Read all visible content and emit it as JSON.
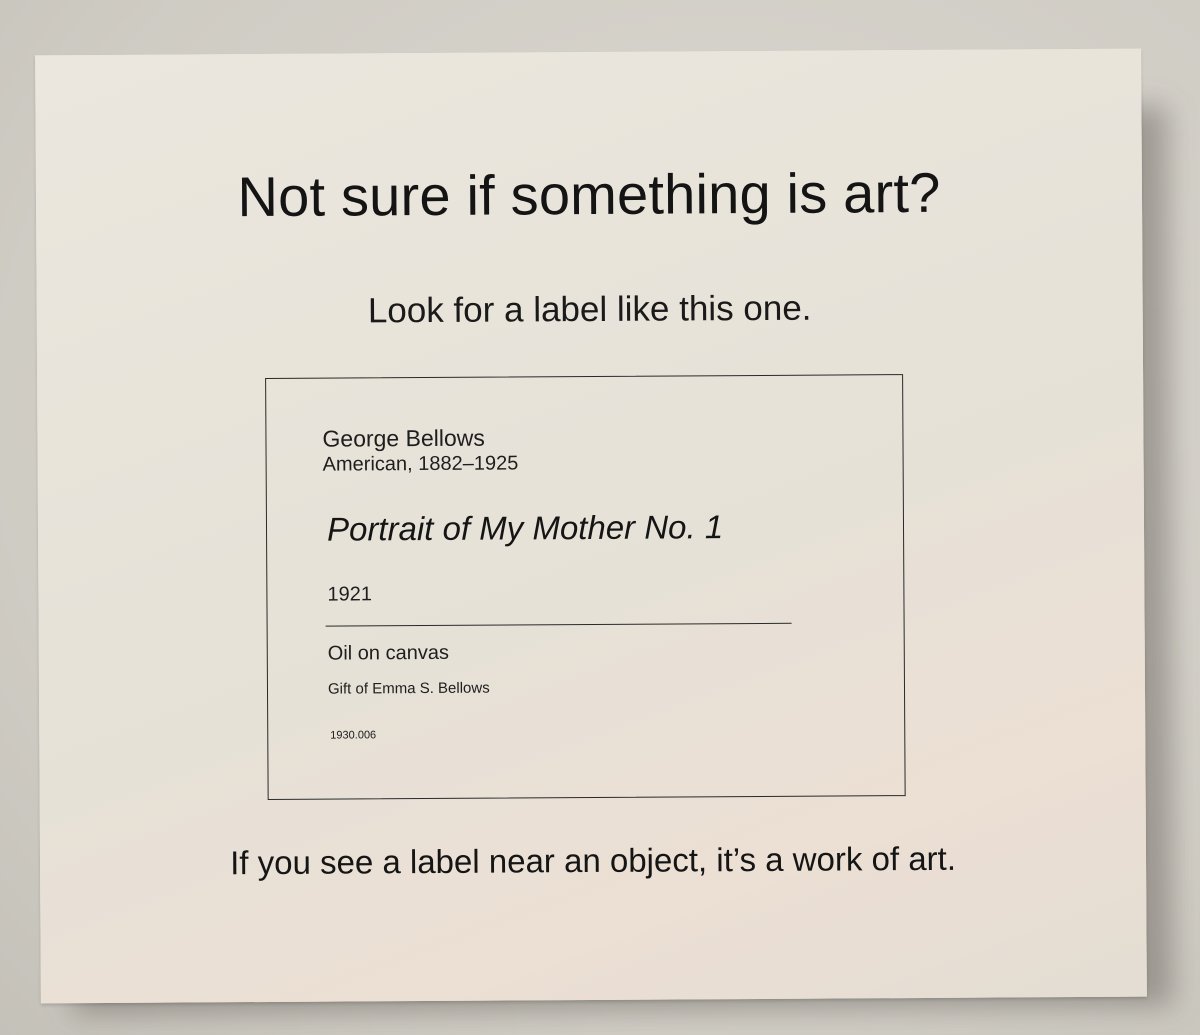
{
  "placard": {
    "headline": "Not sure if something is art?",
    "subhead": "Look for a label like this one.",
    "sample_label": {
      "artist_name": "George Bellows",
      "artist_nationality": "American, 1882–1925",
      "artwork_title": "Portrait of My Mother No. 1",
      "year": "1921",
      "medium": "Oil on canvas",
      "credit_line": "Gift of Emma S. Bellows",
      "accession_number": "1930.006"
    },
    "footer": "If you see a label near an object, it’s a work of art."
  },
  "colors": {
    "wall": "#d6d3cc",
    "placard": "#e9e5dc",
    "ink": "#141414"
  }
}
